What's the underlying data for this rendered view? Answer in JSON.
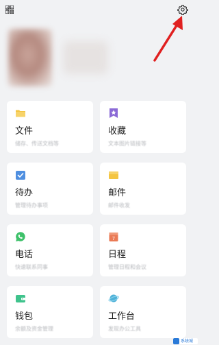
{
  "header": {
    "qr_icon": "qr-code-icon",
    "settings_icon": "gear-icon"
  },
  "profile": {
    "avatar": "avatar-blurred"
  },
  "cards": [
    {
      "title": "文件",
      "subtitle": "储存、传送文档等",
      "icon": "folder-icon",
      "color": "#f4c542"
    },
    {
      "title": "收藏",
      "subtitle": "文本图片链接等",
      "icon": "bookmark-star-icon",
      "color": "#8b6ad6"
    },
    {
      "title": "待办",
      "subtitle": "管理待办事项",
      "icon": "checkbox-icon",
      "color": "#4f8fe0"
    },
    {
      "title": "邮件",
      "subtitle": "邮件收发",
      "icon": "mail-icon",
      "color": "#f4c542"
    },
    {
      "title": "电话",
      "subtitle": "快速联系同事",
      "icon": "phone-chat-icon",
      "color": "#3ec16a"
    },
    {
      "title": "日程",
      "subtitle": "管理日程和会议",
      "icon": "calendar-icon",
      "color": "#ea7a55"
    },
    {
      "title": "钱包",
      "subtitle": "余额及资金管理",
      "icon": "wallet-icon",
      "color": "#3fc38c"
    },
    {
      "title": "工作台",
      "subtitle": "发现办公工具",
      "icon": "workbench-planet-icon",
      "color": "#4fb2d8"
    }
  ],
  "watermark": {
    "text": "系统城"
  }
}
